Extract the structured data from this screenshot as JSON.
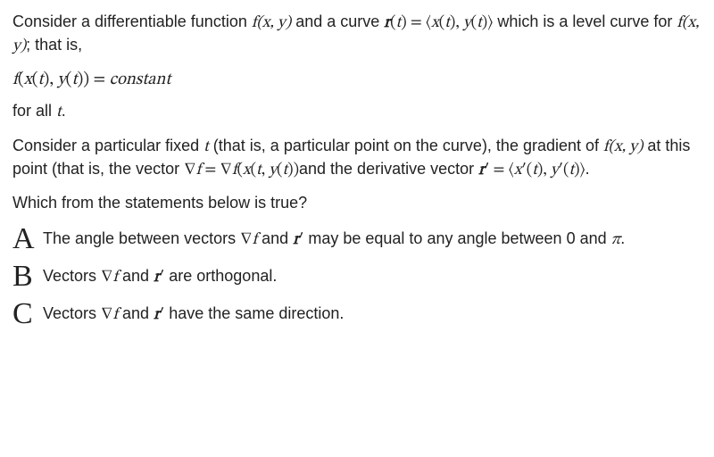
{
  "p1_a": "Consider a differentiable function ",
  "p1_f1": "f(x, y)",
  "p1_b": " and a curve ",
  "p1_f2": "r(t) = ⟨x(t), y(t)⟩",
  "p1_c": " which is a level curve for ",
  "p1_f3": "f(x, y)",
  "p1_d": "; that is,",
  "eq1": "f(x(t), y(t)) = constant",
  "p2": "for all ",
  "p2_t": "t",
  "p2_end": ".",
  "p3_a": "Consider a particular fixed  ",
  "p3_t": "t",
  "p3_b": " (that is,  a particular point on the curve),  the gradient of ",
  "p3_f1": "f(x, y)",
  "p3_c": " at this point (that is, the vector ",
  "p3_f2": "∇f = ∇f(x(t, y(t))",
  "p3_d": "and the derivative vector ",
  "p3_f3": "r′ = ⟨x′(t), y′(t)⟩",
  "p3_e": ".",
  "q": "Which from the statements below is true?",
  "optA_letter": "A",
  "optA_a": "The angle between vectors ",
  "optA_f1": "∇f",
  "optA_b": " and ",
  "optA_f2": "r′",
  "optA_c": " may be equal to any angle between 0 and ",
  "optA_pi": "π",
  "optA_d": ".",
  "optB_letter": "B",
  "optB_a": "Vectors ",
  "optB_f1": "∇f",
  "optB_b": " and ",
  "optB_f2": "r′",
  "optB_c": " are orthogonal.",
  "optC_letter": "C",
  "optC_a": "Vectors ",
  "optC_f1": "∇f",
  "optC_b": " and ",
  "optC_f2": "r′",
  "optC_c": " have the same direction."
}
